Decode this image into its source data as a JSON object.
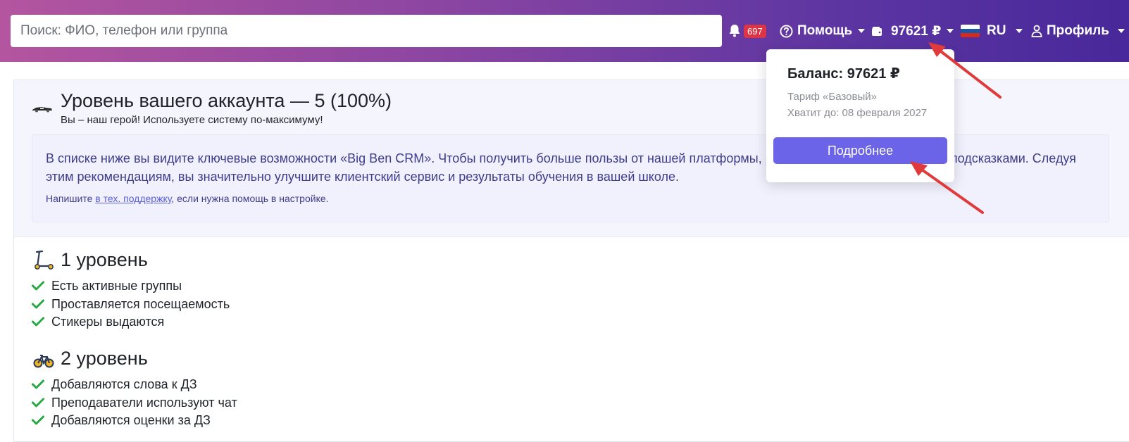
{
  "header": {
    "search_placeholder": "Поиск: ФИО, телефон или группа",
    "notifications_count": "697",
    "help_label": "Помощь",
    "balance_label": "97621 ₽",
    "language_label": "RU",
    "profile_label": "Профиль"
  },
  "account": {
    "title": "Уровень вашего аккаунта — 5 (100%)",
    "subtitle": "Вы – наш герой! Используете систему по-максимуму!",
    "info_text": "В списке ниже вы видите ключевые возможности «Big Ben CRM». Чтобы получить больше пользы от нашей платформы, рекомендуем воспользоваться подсказками. Следуя этим рекомендациям, вы значительно улучшите клиентский сервис и результаты обучения в вашей школе.",
    "info_prefix": "Напишите ",
    "support_link": "в тех. поддержку",
    "info_suffix": ", если нужна помощь в настройке."
  },
  "levels": [
    {
      "title": "1 уровень",
      "icon": "scooter-icon",
      "items": [
        "Есть активные группы",
        "Проставляется посещаемость",
        "Стикеры выдаются"
      ]
    },
    {
      "title": "2 уровень",
      "icon": "bicycle-icon",
      "items": [
        "Добавляются слова к ДЗ",
        "Преподаватели используют чат",
        "Добавляются оценки за ДЗ"
      ]
    }
  ],
  "balance_dropdown": {
    "title": "Баланс: 97621 ₽",
    "tariff": "Тариф «Базовый»",
    "valid_until": "Хватит до: 08 февраля 2027",
    "button": "Подробнее"
  },
  "colors": {
    "accent": "#6b63e8",
    "check": "#28a745",
    "badge": "#dc3545",
    "annotation_arrow": "#e03a3a"
  }
}
